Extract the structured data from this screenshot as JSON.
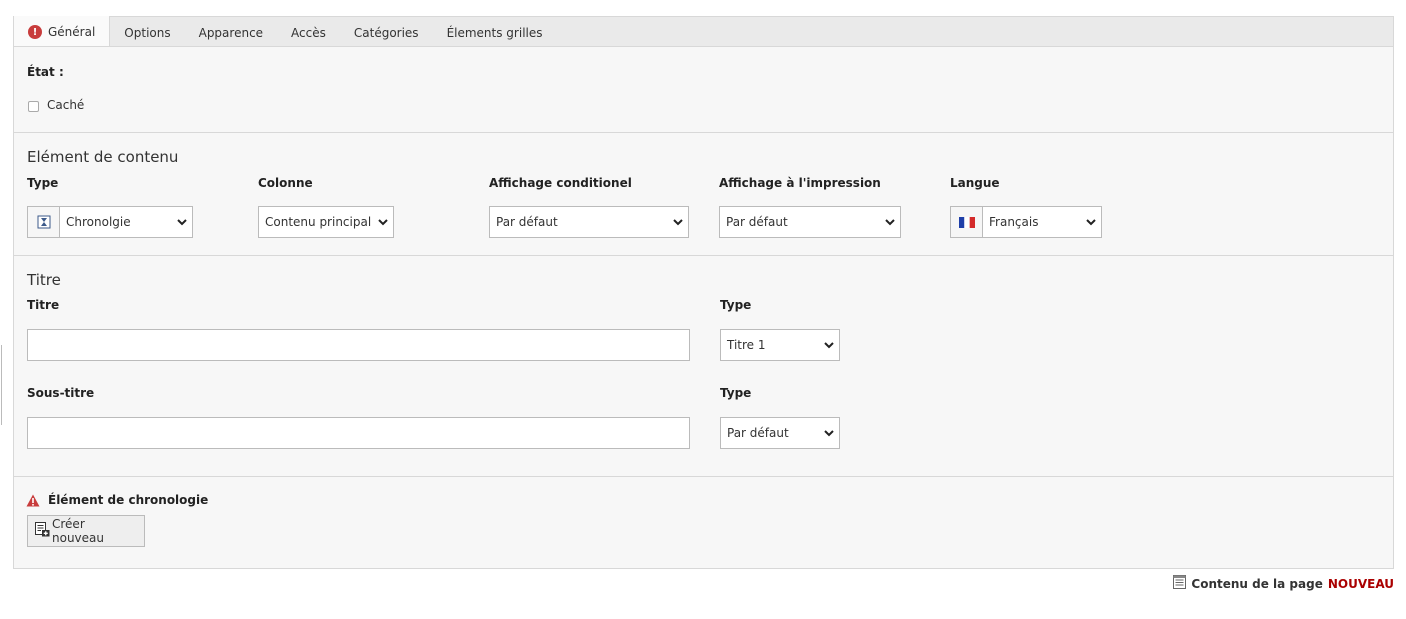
{
  "tabs": [
    {
      "label": "Général",
      "active": true,
      "error": true
    },
    {
      "label": "Options"
    },
    {
      "label": "Apparence"
    },
    {
      "label": "Accès"
    },
    {
      "label": "Catégories"
    },
    {
      "label": "Élements grilles"
    }
  ],
  "etat": {
    "label": "État :",
    "hidden_label": "Caché",
    "hidden_checked": false
  },
  "content_element": {
    "title": "Elément de contenu",
    "type": {
      "label": "Type",
      "value": "Chronolgie",
      "icon": "hourglass-icon"
    },
    "colonne": {
      "label": "Colonne",
      "value": "Contenu principal"
    },
    "affichage_cond": {
      "label": "Affichage conditionel",
      "value": "Par défaut"
    },
    "affichage_impr": {
      "label": "Affichage à l'impression",
      "value": "Par défaut"
    },
    "langue": {
      "label": "Langue",
      "value": "Français",
      "icon": "flag-fr-icon"
    }
  },
  "titre_section": {
    "title": "Titre",
    "titre": {
      "label": "Titre",
      "value": "",
      "placeholder": ""
    },
    "titre_type": {
      "label": "Type",
      "value": "Titre 1"
    },
    "sous_titre": {
      "label": "Sous-titre",
      "value": "",
      "placeholder": ""
    },
    "sous_titre_type": {
      "label": "Type",
      "value": "Par défaut"
    }
  },
  "chronologie": {
    "label": "Élément de chronologie",
    "create_button": "Créer nouveau"
  },
  "footer": {
    "label": "Contenu de la page",
    "status": "NOUVEAU"
  },
  "colors": {
    "error": "#c83c3c",
    "new_status": "#aa0000",
    "panel_bg": "#f7f7f7",
    "tabbar_bg": "#eaeaea"
  }
}
